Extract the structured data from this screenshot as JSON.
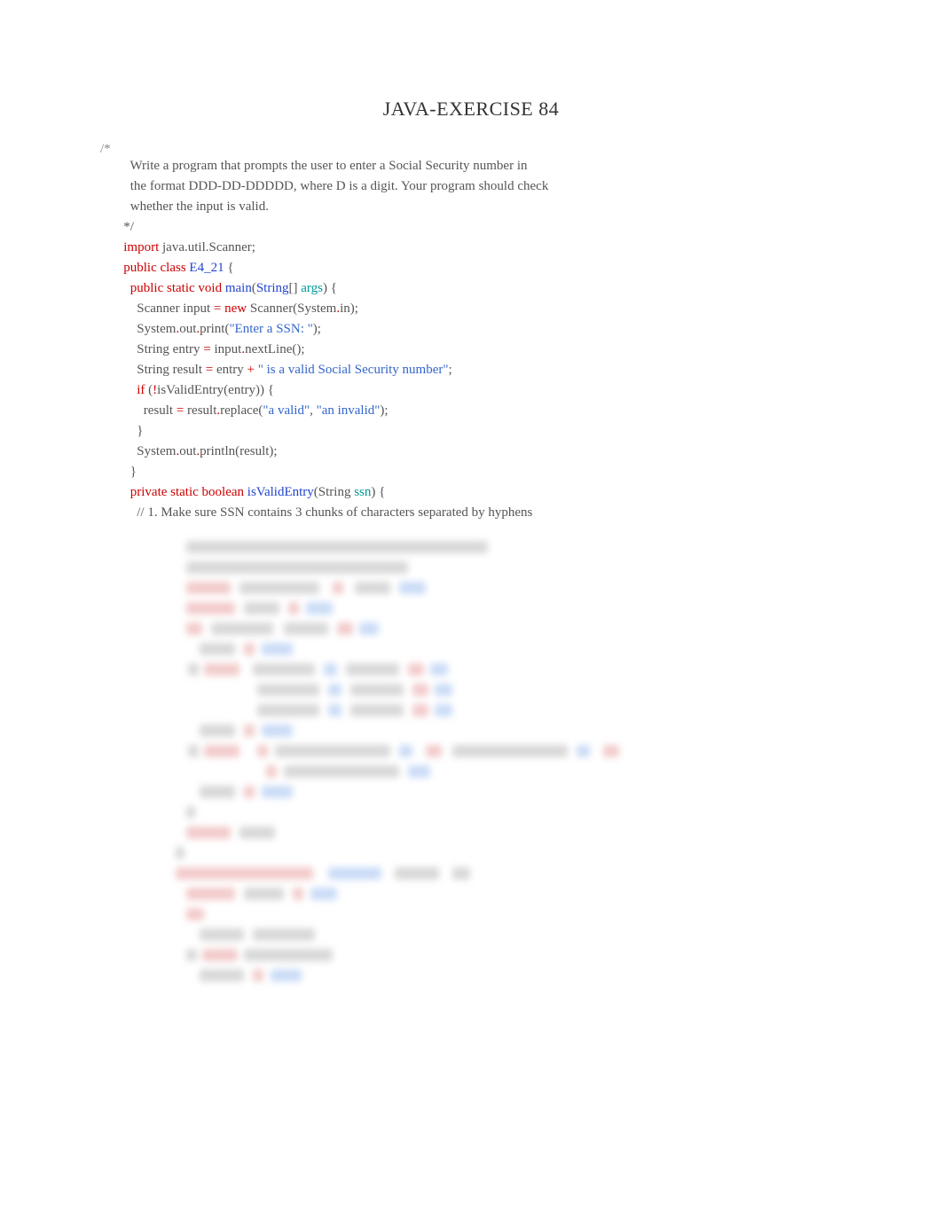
{
  "title": "JAVA-EXERCISE 84",
  "open_comment": "/*",
  "code": {
    "c1": "Write a program that prompts the user to enter a Social Security number in",
    "c2": "the format DDD-DD-DDDDD, where D is a digit. Your program should check",
    "c3": "whether the input is valid.",
    "c4": "*/",
    "import_kw": "import",
    "import_rest": " java.util.Scanner;",
    "public_class": "public class ",
    "class_name": "E4_21",
    "class_brace": " {",
    "psv": "public static void ",
    "main": "main",
    "lparen": "(",
    "string_type": "String",
    "array_brackets": "[] ",
    "args_param": "args",
    "rparen_brace": ") {",
    "scanner_decl1": "Scanner input ",
    "eq": "=",
    "new_kw": " new ",
    "scanner_decl2": "Scanner(System",
    "dot": ".",
    "in_end": "in);",
    "system1": "System",
    "out1": "out",
    "print1": "print(",
    "enter_ssn": "\"Enter a SSN: \"",
    "close1": ");",
    "string_entry": "String entry ",
    "input_nextline": " input",
    "nextline_end": "nextLine();",
    "string_result": "String result ",
    "entry_var": " entry ",
    "plus": "+",
    "valid_msg": " \" is a valid Social Security number\"",
    "semicolon": ";",
    "if_kw": "if",
    "bang": "!",
    "isvalid_call": "isValidEntry(entry)) {",
    "result_var": "result ",
    "result_var2": " result",
    "replace_call": "replace(",
    "a_valid": "\"a valid\"",
    "comma": ", ",
    "an_invalid": "\"an invalid\"",
    "close2": ");",
    "brace_close": "}",
    "system2": "System",
    "out2": "out",
    "println2": "println(result);",
    "psb": "private static boolean ",
    "isvalid_name": "isValidEntry",
    "isvalid_params_open": "(String ",
    "ssn_param": "ssn",
    "isvalid_params_close": ") {",
    "comment_line": "// 1. Make sure SSN contains 3 chunks of characters separated by hyphens",
    "lparen_space": "("
  }
}
